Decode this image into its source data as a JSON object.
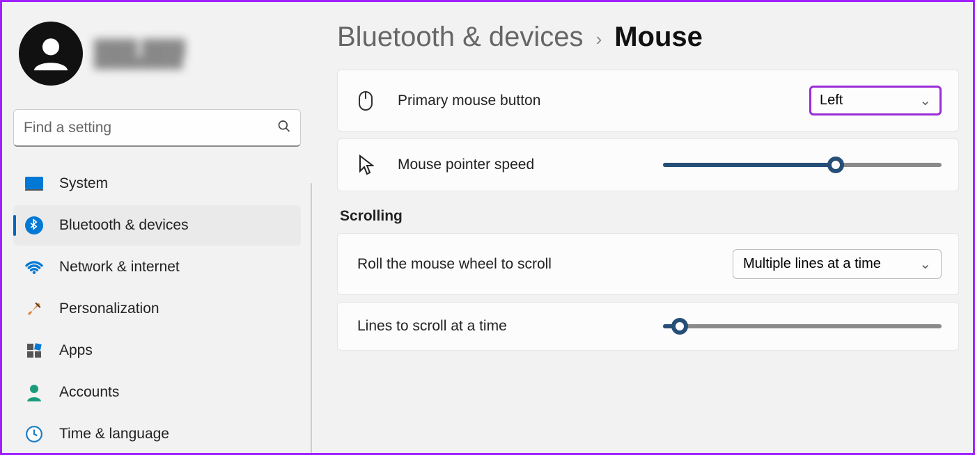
{
  "search": {
    "placeholder": "Find a setting"
  },
  "sidebar": {
    "items": [
      {
        "label": "System"
      },
      {
        "label": "Bluetooth & devices"
      },
      {
        "label": "Network & internet"
      },
      {
        "label": "Personalization"
      },
      {
        "label": "Apps"
      },
      {
        "label": "Accounts"
      },
      {
        "label": "Time & language"
      }
    ]
  },
  "breadcrumb": {
    "parent": "Bluetooth & devices",
    "current": "Mouse"
  },
  "main": {
    "primary_button": {
      "label": "Primary mouse button",
      "value": "Left"
    },
    "pointer_speed": {
      "label": "Mouse pointer speed",
      "percent": 62
    },
    "scrolling_header": "Scrolling",
    "wheel_scroll": {
      "label": "Roll the mouse wheel to scroll",
      "value": "Multiple lines at a time"
    },
    "lines_scroll": {
      "label": "Lines to scroll at a time",
      "percent": 6
    }
  }
}
